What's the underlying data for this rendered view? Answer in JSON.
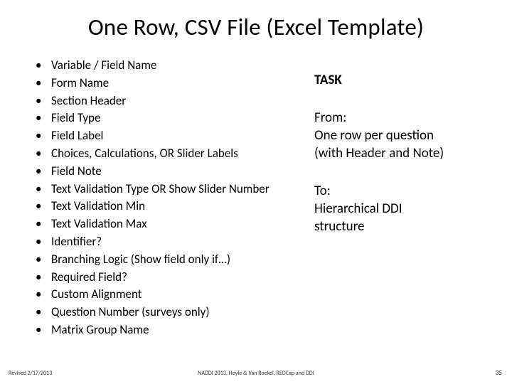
{
  "title": "One Row, CSV File (Excel Template)",
  "bullets": [
    "Variable / Field Name",
    "Form Name",
    "Section Header",
    "Field Type",
    "Field Label",
    "Choices, Calculations, OR Slider Labels",
    "Field Note",
    "Text Validation Type OR Show Slider Number",
    "Text Validation Min",
    "Text Validation Max",
    "Identifier?",
    "Branching Logic (Show field only if…)",
    "Required Field?",
    "Custom Alignment",
    "Question Number (surveys only)",
    "Matrix Group Name"
  ],
  "task": {
    "heading": "TASK",
    "from_label": "From:",
    "from_line1": " One row per question",
    "from_line2": "(with Header and Note)",
    "to_label": "To:",
    "to_line1": "Hierarchical DDI",
    "to_line2": "structure"
  },
  "footer": {
    "left": "Revised 2/17/2013",
    "center": "NADDI 2013, Hoyle & Van Roekel, REDCap and DDI",
    "right": "35"
  }
}
